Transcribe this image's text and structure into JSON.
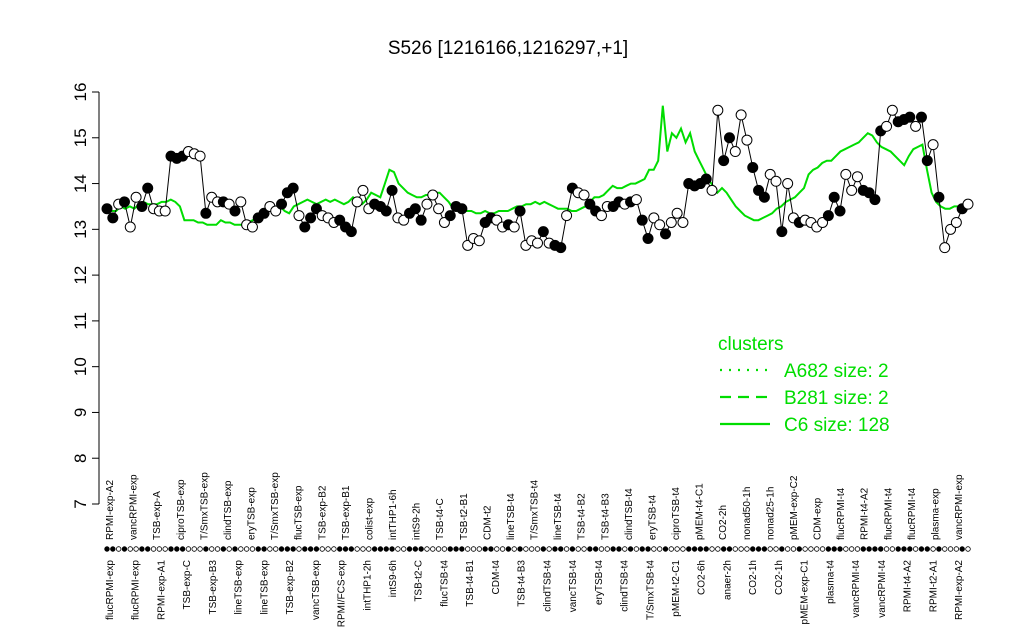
{
  "chart_data": {
    "type": "line",
    "title": "S526 [1216166,1216297,+1]",
    "xlabel": "",
    "ylabel": "",
    "ylim": [
      7,
      16
    ],
    "yticks": [
      7,
      8,
      9,
      10,
      11,
      12,
      13,
      14,
      15,
      16
    ],
    "x_labels_top": [
      "RPMI-exp-A2",
      "vancRPMI-exp",
      "TSB-exp-A",
      "ciproTSB-exp",
      "T/SmxTSB-exp",
      "clindTSB-exp",
      "eryTSB-exp",
      "T/SmxTSB-exp",
      "flucTSB-exp",
      "TSB-exp-B2",
      "TSB-exp-B1",
      "colist-exp",
      "intTHP1-6h",
      "intS9-2h",
      "TSB-t4-C",
      "TSB-t2-B1",
      "CDM-t2",
      "lineTSB-t4",
      "T/SmxTSB-t4",
      "lineTSB-t4",
      "TSB-t4-B2",
      "TSB-t4-B3",
      "clindTSB-t4",
      "eryTSB-t4",
      "ciproTSB-t4",
      "pMEM-t4-C1",
      "CO2-2h",
      "nonad50-1h",
      "nonad25-1h",
      "pMEM-exp-C2",
      "CDM-exp",
      "flucRPMI-t4",
      "RPMI-t4-A2",
      "flucRPMI-t4",
      "flucRPMI-t4",
      "plasma-exp",
      "vancRPMI-exp"
    ],
    "x_labels_bottom": [
      "flucRPMI-exp",
      "flucRPMI-exp",
      "RPMI-exp-A1",
      "TSB-exp-C",
      "TSB-exp-B3",
      "lineTSB-exp",
      "lineTSB-exp",
      "TSB-exp-B2",
      "vancTSB-exp",
      "RPMI/FCS-exp",
      "intTHP1-2h",
      "intS9-6h",
      "TSB-t2-C",
      "flucTSB-t4",
      "TSB-t4-B1",
      "CDM-t4",
      "TSB-t4-B3",
      "clindTSB-t4",
      "vancTSB-t4",
      "eryTSB-t4",
      "clindTSB-t4",
      "T/SmxTSB-t4",
      "pMEM-t2-C1",
      "CO2-6h",
      "anaer-2h",
      "CO2-1h",
      "CO2-1h",
      "pMEM-exp-C1",
      "plasma-t4",
      "vancRPMI-t4",
      "vancRPMI-t4",
      "RPMI-t4-A2",
      "RPMI-t2-A1",
      "RPMI-exp-A2"
    ],
    "legend": {
      "title": "clusters",
      "placement": "right",
      "entries": [
        "A682 size: 2",
        "B281 size: 2",
        "C6 size: 128"
      ],
      "styles": [
        "dotted",
        "dashed",
        "solid"
      ]
    },
    "color": "#00dd00",
    "samples": [
      {
        "y": 13.45,
        "f": "black"
      },
      {
        "y": 13.25,
        "f": "black"
      },
      {
        "y": 13.55,
        "f": "white"
      },
      {
        "y": 13.6,
        "f": "black"
      },
      {
        "y": 13.05,
        "f": "white"
      },
      {
        "y": 13.7,
        "f": "white"
      },
      {
        "y": 13.5,
        "f": "black"
      },
      {
        "y": 13.9,
        "f": "black"
      },
      {
        "y": 13.45,
        "f": "white"
      },
      {
        "y": 13.4,
        "f": "white"
      },
      {
        "y": 13.4,
        "f": "white"
      },
      {
        "y": 14.6,
        "f": "black"
      },
      {
        "y": 14.55,
        "f": "black"
      },
      {
        "y": 14.6,
        "f": "black"
      },
      {
        "y": 14.7,
        "f": "white"
      },
      {
        "y": 14.65,
        "f": "white"
      },
      {
        "y": 14.6,
        "f": "white"
      },
      {
        "y": 13.35,
        "f": "black"
      },
      {
        "y": 13.7,
        "f": "white"
      },
      {
        "y": 13.6,
        "f": "white"
      },
      {
        "y": 13.6,
        "f": "black"
      },
      {
        "y": 13.55,
        "f": "white"
      },
      {
        "y": 13.4,
        "f": "black"
      },
      {
        "y": 13.6,
        "f": "white"
      },
      {
        "y": 13.1,
        "f": "white"
      },
      {
        "y": 13.05,
        "f": "white"
      },
      {
        "y": 13.25,
        "f": "black"
      },
      {
        "y": 13.35,
        "f": "black"
      },
      {
        "y": 13.5,
        "f": "white"
      },
      {
        "y": 13.4,
        "f": "white"
      },
      {
        "y": 13.55,
        "f": "black"
      },
      {
        "y": 13.8,
        "f": "black"
      },
      {
        "y": 13.9,
        "f": "black"
      },
      {
        "y": 13.3,
        "f": "white"
      },
      {
        "y": 13.05,
        "f": "black"
      },
      {
        "y": 13.25,
        "f": "black"
      },
      {
        "y": 13.45,
        "f": "black"
      },
      {
        "y": 13.3,
        "f": "white"
      },
      {
        "y": 13.25,
        "f": "white"
      },
      {
        "y": 13.15,
        "f": "white"
      },
      {
        "y": 13.2,
        "f": "black"
      },
      {
        "y": 13.05,
        "f": "black"
      },
      {
        "y": 12.95,
        "f": "black"
      },
      {
        "y": 13.6,
        "f": "white"
      },
      {
        "y": 13.85,
        "f": "white"
      },
      {
        "y": 13.45,
        "f": "white"
      },
      {
        "y": 13.55,
        "f": "black"
      },
      {
        "y": 13.5,
        "f": "black"
      },
      {
        "y": 13.4,
        "f": "black"
      },
      {
        "y": 13.85,
        "f": "black"
      },
      {
        "y": 13.25,
        "f": "white"
      },
      {
        "y": 13.2,
        "f": "white"
      },
      {
        "y": 13.35,
        "f": "black"
      },
      {
        "y": 13.45,
        "f": "black"
      },
      {
        "y": 13.2,
        "f": "black"
      },
      {
        "y": 13.55,
        "f": "white"
      },
      {
        "y": 13.75,
        "f": "white"
      },
      {
        "y": 13.45,
        "f": "white"
      },
      {
        "y": 13.15,
        "f": "white"
      },
      {
        "y": 13.3,
        "f": "black"
      },
      {
        "y": 13.5,
        "f": "black"
      },
      {
        "y": 13.45,
        "f": "black"
      },
      {
        "y": 12.65,
        "f": "white"
      },
      {
        "y": 12.8,
        "f": "white"
      },
      {
        "y": 12.75,
        "f": "white"
      },
      {
        "y": 13.15,
        "f": "black"
      },
      {
        "y": 13.25,
        "f": "black"
      },
      {
        "y": 13.2,
        "f": "white"
      },
      {
        "y": 13.05,
        "f": "white"
      },
      {
        "y": 13.1,
        "f": "black"
      },
      {
        "y": 13.05,
        "f": "white"
      },
      {
        "y": 13.4,
        "f": "black"
      },
      {
        "y": 12.65,
        "f": "white"
      },
      {
        "y": 12.75,
        "f": "white"
      },
      {
        "y": 12.7,
        "f": "white"
      },
      {
        "y": 12.95,
        "f": "black"
      },
      {
        "y": 12.7,
        "f": "white"
      },
      {
        "y": 12.65,
        "f": "black"
      },
      {
        "y": 12.6,
        "f": "black"
      },
      {
        "y": 13.3,
        "f": "white"
      },
      {
        "y": 13.9,
        "f": "black"
      },
      {
        "y": 13.8,
        "f": "white"
      },
      {
        "y": 13.75,
        "f": "white"
      },
      {
        "y": 13.55,
        "f": "black"
      },
      {
        "y": 13.4,
        "f": "black"
      },
      {
        "y": 13.3,
        "f": "white"
      },
      {
        "y": 13.5,
        "f": "white"
      },
      {
        "y": 13.5,
        "f": "black"
      },
      {
        "y": 13.6,
        "f": "black"
      },
      {
        "y": 13.55,
        "f": "white"
      },
      {
        "y": 13.6,
        "f": "black"
      },
      {
        "y": 13.65,
        "f": "white"
      },
      {
        "y": 13.2,
        "f": "black"
      },
      {
        "y": 12.8,
        "f": "black"
      },
      {
        "y": 13.25,
        "f": "white"
      },
      {
        "y": 13.1,
        "f": "white"
      },
      {
        "y": 12.9,
        "f": "black"
      },
      {
        "y": 13.15,
        "f": "white"
      },
      {
        "y": 13.35,
        "f": "white"
      },
      {
        "y": 13.15,
        "f": "white"
      },
      {
        "y": 14.0,
        "f": "black"
      },
      {
        "y": 13.95,
        "f": "black"
      },
      {
        "y": 14.0,
        "f": "black"
      },
      {
        "y": 14.1,
        "f": "black"
      },
      {
        "y": 13.85,
        "f": "white"
      },
      {
        "y": 15.6,
        "f": "white"
      },
      {
        "y": 14.5,
        "f": "black"
      },
      {
        "y": 15.0,
        "f": "black"
      },
      {
        "y": 14.7,
        "f": "white"
      },
      {
        "y": 15.5,
        "f": "white"
      },
      {
        "y": 14.95,
        "f": "white"
      },
      {
        "y": 14.35,
        "f": "black"
      },
      {
        "y": 13.85,
        "f": "black"
      },
      {
        "y": 13.7,
        "f": "black"
      },
      {
        "y": 14.2,
        "f": "white"
      },
      {
        "y": 14.05,
        "f": "white"
      },
      {
        "y": 12.95,
        "f": "black"
      },
      {
        "y": 14.0,
        "f": "white"
      },
      {
        "y": 13.25,
        "f": "white"
      },
      {
        "y": 13.15,
        "f": "black"
      },
      {
        "y": 13.2,
        "f": "white"
      },
      {
        "y": 13.15,
        "f": "white"
      },
      {
        "y": 13.05,
        "f": "white"
      },
      {
        "y": 13.15,
        "f": "white"
      },
      {
        "y": 13.3,
        "f": "black"
      },
      {
        "y": 13.7,
        "f": "black"
      },
      {
        "y": 13.4,
        "f": "black"
      },
      {
        "y": 14.2,
        "f": "white"
      },
      {
        "y": 13.85,
        "f": "white"
      },
      {
        "y": 14.15,
        "f": "white"
      },
      {
        "y": 13.85,
        "f": "black"
      },
      {
        "y": 13.8,
        "f": "black"
      },
      {
        "y": 13.65,
        "f": "black"
      },
      {
        "y": 15.15,
        "f": "black"
      },
      {
        "y": 15.25,
        "f": "white"
      },
      {
        "y": 15.6,
        "f": "white"
      },
      {
        "y": 15.35,
        "f": "black"
      },
      {
        "y": 15.4,
        "f": "black"
      },
      {
        "y": 15.45,
        "f": "black"
      },
      {
        "y": 15.25,
        "f": "white"
      },
      {
        "y": 15.45,
        "f": "black"
      },
      {
        "y": 14.5,
        "f": "black"
      },
      {
        "y": 14.85,
        "f": "white"
      },
      {
        "y": 13.7,
        "f": "black"
      },
      {
        "y": 12.6,
        "f": "white"
      },
      {
        "y": 13.0,
        "f": "white"
      },
      {
        "y": 13.15,
        "f": "white"
      },
      {
        "y": 13.45,
        "f": "black"
      },
      {
        "y": 13.55,
        "f": "white"
      }
    ],
    "series": [
      {
        "name": "C6 size: 128",
        "style": "solid",
        "values": [
          13.4,
          13.4,
          13.4,
          13.5,
          13.45,
          13.5,
          13.45,
          13.55,
          13.6,
          13.55,
          13.55,
          13.55,
          13.6,
          13.6,
          13.65,
          13.6,
          13.5,
          13.2,
          13.2,
          13.2,
          13.15,
          13.15,
          13.1,
          13.1,
          13.1,
          13.2,
          13.15,
          13.15,
          13.1,
          13.1,
          13.1,
          13.15,
          13.2,
          13.25,
          13.3,
          13.4,
          13.45,
          13.4,
          13.5,
          13.4,
          13.35,
          13.5,
          13.55,
          13.6,
          13.65,
          13.6,
          13.55,
          13.6,
          13.65,
          13.6,
          13.65,
          13.6,
          13.55,
          13.6,
          13.7,
          13.6,
          13.55,
          13.65,
          13.8,
          13.75,
          13.7,
          14.0,
          14.3,
          14.25,
          14.0,
          13.9,
          13.8,
          13.75,
          13.7,
          13.7,
          13.75,
          13.75,
          13.8,
          13.8,
          13.7,
          13.6,
          13.45,
          13.4,
          13.5,
          13.4,
          13.4,
          13.35,
          13.35,
          13.4,
          13.35,
          13.35,
          13.4,
          13.4,
          13.4,
          13.45,
          13.5,
          13.5,
          13.55,
          13.55,
          13.6,
          13.55,
          13.6,
          13.55,
          13.5,
          13.45,
          13.45,
          13.45,
          13.4,
          13.4,
          13.45,
          13.5,
          13.6,
          13.7,
          13.7,
          13.75,
          13.85,
          13.95,
          13.9,
          13.9,
          13.95,
          14.0,
          14.0,
          14.05,
          14.1,
          14.3,
          14.3,
          14.5,
          15.7,
          14.7,
          15.1,
          15.0,
          15.2,
          14.9,
          15.1,
          14.7,
          14.5,
          14.3,
          14.1,
          13.95,
          13.8,
          13.9,
          13.8,
          13.65,
          13.5,
          13.4,
          13.3,
          13.25,
          13.2,
          13.2,
          13.25,
          13.3,
          13.35,
          13.45,
          13.5,
          13.6,
          13.65,
          13.7,
          13.8,
          13.9,
          14.2,
          14.3,
          14.35,
          14.45,
          14.5,
          14.5,
          14.6,
          14.7,
          14.75,
          14.8,
          14.85,
          14.9,
          15.0,
          15.1,
          15.05,
          14.9,
          14.8,
          14.75,
          14.7,
          14.6,
          14.5,
          14.4,
          14.6,
          14.75,
          14.8,
          14.85,
          14.3,
          13.8,
          13.6,
          13.5,
          13.45,
          13.45,
          13.5,
          13.5,
          13.55,
          13.6
        ]
      },
      {
        "name": "B281 size: 2",
        "style": "dashed",
        "values": []
      },
      {
        "name": "A682 size: 2",
        "style": "dotted",
        "values": []
      }
    ]
  }
}
